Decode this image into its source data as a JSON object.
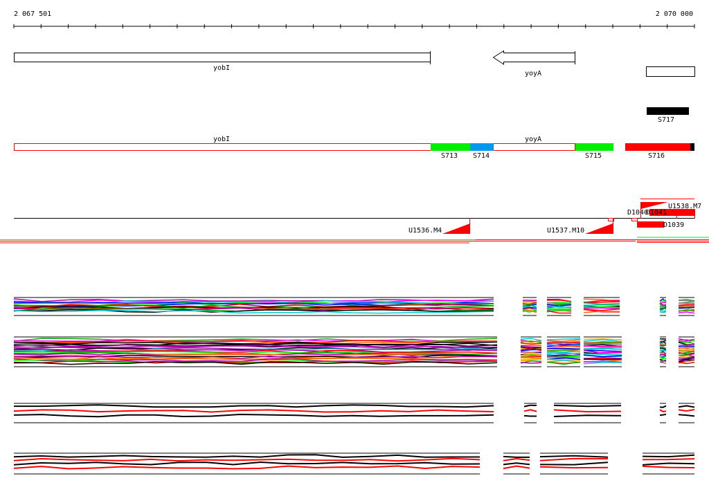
{
  "ruler": {
    "start_label": "2 067 501",
    "end_label": "2 070 000",
    "tick_count": 25
  },
  "genes": [
    {
      "name": "yobI",
      "strand": "+"
    },
    {
      "name": "yoyA",
      "strand": "-"
    }
  ],
  "segments": {
    "S717": "S717",
    "S713": "S713",
    "S714": "S714",
    "S715": "S715",
    "S716": "S716"
  },
  "annotation_genes": {
    "yobI": "yobI",
    "yoyA": "yoyA"
  },
  "features": {
    "U1536": "U1536.M4",
    "U1537": "U1537.M10",
    "U1538": "U1538.M7",
    "D1040": "D1040",
    "D1041": "D1041",
    "D1039": "D1039"
  },
  "colors": {
    "green": "#00ee00",
    "blue": "#0099ee",
    "red": "#ff0000",
    "black": "#000000"
  }
}
